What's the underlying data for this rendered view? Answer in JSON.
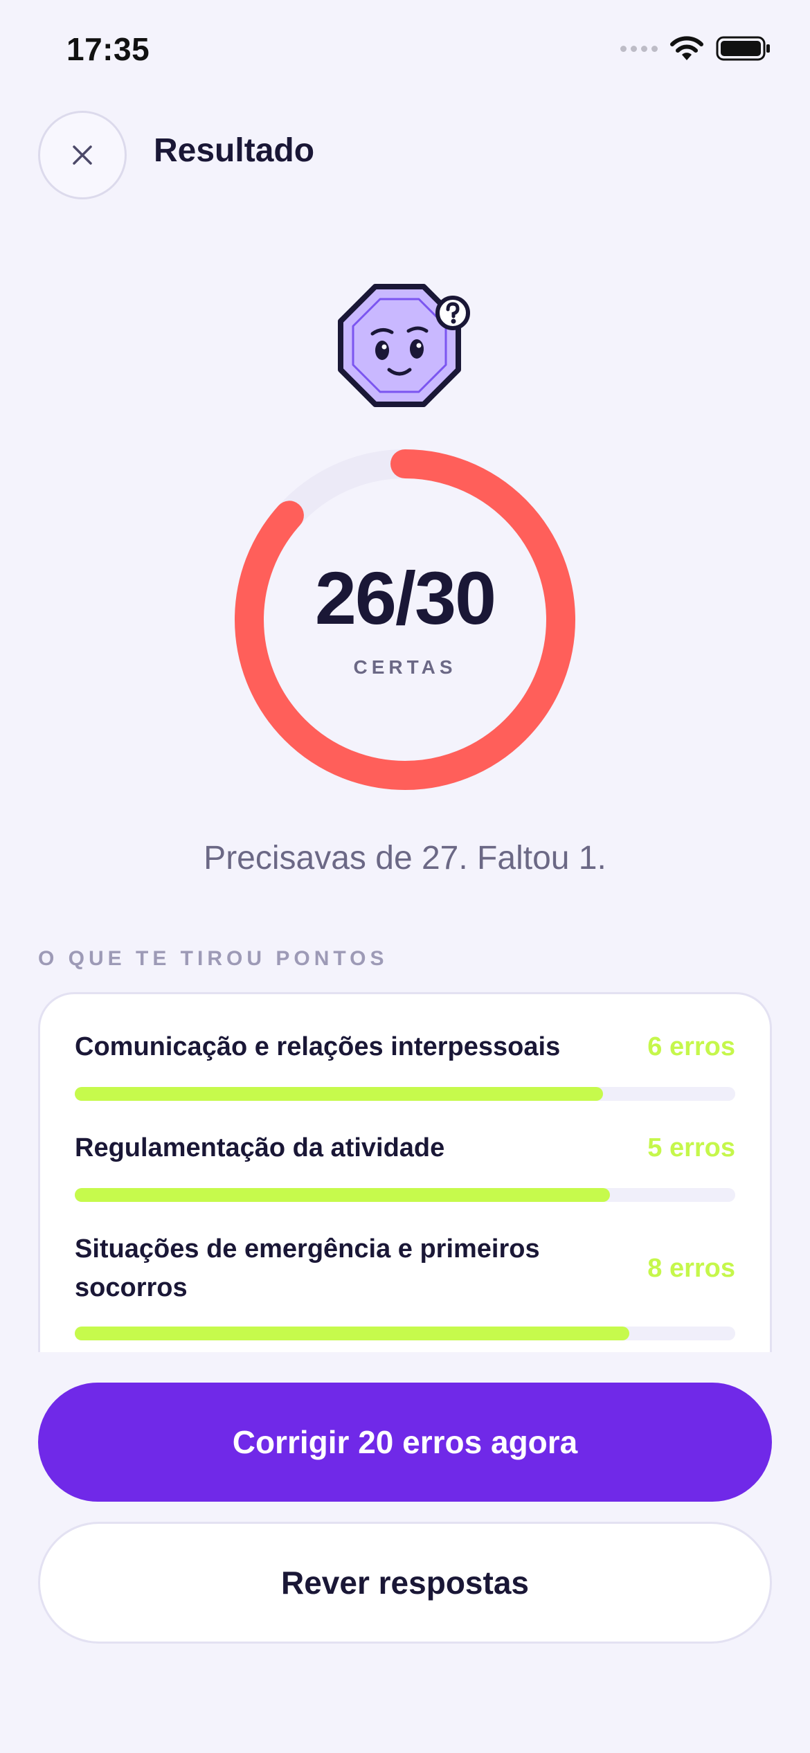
{
  "status_bar": {
    "time": "17:35"
  },
  "header": {
    "title": "Resultado"
  },
  "result": {
    "correct": 26,
    "total": 30,
    "score_text": "26/30",
    "score_label": "CERTAS",
    "summary": "Precisavas de 27. Faltou 1."
  },
  "breakdown": {
    "section_label": "O QUE TE TIROU PONTOS",
    "categories": [
      {
        "name": "Comunicação e relações interpessoais",
        "count_label": "6 erros",
        "progress": 0.8
      },
      {
        "name": "Regulamentação da atividade",
        "count_label": "5 erros",
        "progress": 0.81
      },
      {
        "name": "Situações de emergência e primeiros socorros",
        "count_label": "8 erros",
        "progress": 0.84
      }
    ]
  },
  "actions": {
    "primary_label": "Corrigir 20 erros agora",
    "secondary_label": "Rever respostas"
  },
  "colors": {
    "background": "#F4F3FC",
    "ring": "#FF5F5A",
    "ring_track": "#ECEAF7",
    "progress": "#C6FA4C",
    "primary": "#7029E8",
    "mascot": "#C9B8FF"
  }
}
